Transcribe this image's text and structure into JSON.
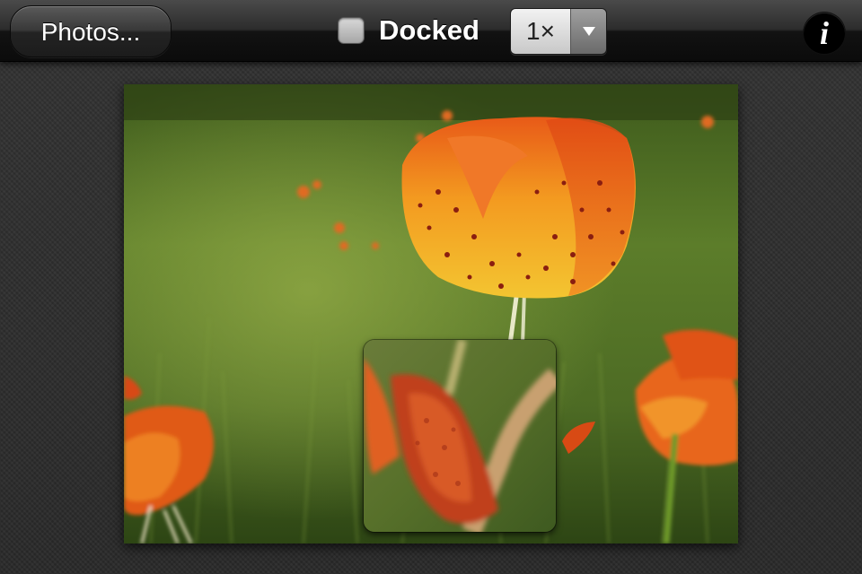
{
  "toolbar": {
    "photos_label": "Photos...",
    "docked_label": "Docked",
    "docked_checked": false,
    "zoom_value": "1×",
    "info_label": "i"
  }
}
